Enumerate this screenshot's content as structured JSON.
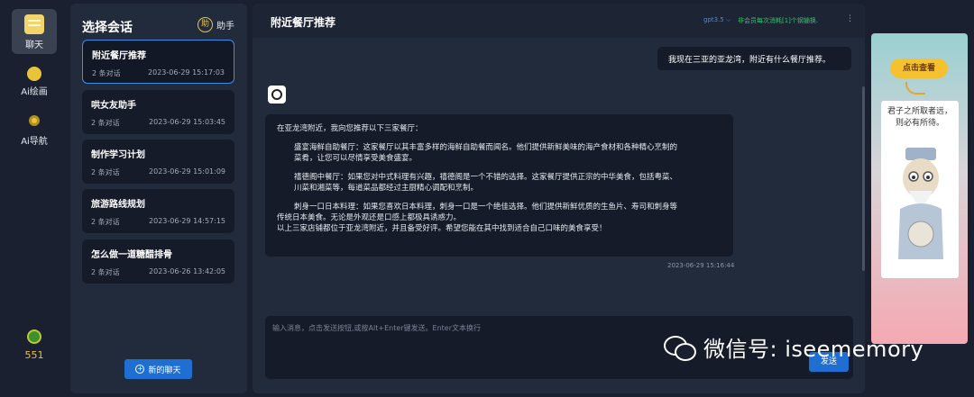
{
  "rail": {
    "chat_label": "聊天",
    "draw_label": "Ai绘画",
    "nav_label": "Ai导航",
    "coins": "551"
  },
  "conversations": {
    "heading": "选择会话",
    "assistant_badge": "助",
    "assistant_label": "助手",
    "items": [
      {
        "title": "附近餐厅推荐",
        "count": "2 条对话",
        "time": "2023-06-29 15:17:03",
        "active": true
      },
      {
        "title": "哄女友助手",
        "count": "2 条对话",
        "time": "2023-06-29 15:03:45",
        "active": false
      },
      {
        "title": "制作学习计划",
        "count": "2 条对话",
        "time": "2023-06-29 15:01:09",
        "active": false
      },
      {
        "title": "旅游路线规划",
        "count": "2 条对话",
        "time": "2023-06-29 14:57:15",
        "active": false
      },
      {
        "title": "怎么做一道糖醋排骨",
        "count": "2 条对话",
        "time": "2023-06-26 13:42:05",
        "active": false
      }
    ],
    "new_chat_label": "新的聊天"
  },
  "chat": {
    "title": "附近餐厅推荐",
    "model": "gpt3.5",
    "model_note": "非会员每次消耗[1]个钢镚换.",
    "menu": "⋮",
    "user_message": "我现在三亚的亚龙湾，附近有什么餐厅推荐。",
    "bot_lines": {
      "intro": "在亚龙湾附近，我向您推荐以下三家餐厅：",
      "r1a": "盛宴海鲜自助餐厅：这家餐厅以其丰富多样的海鲜自助餐而闻名。他们提供新鲜美味的海产食材和各种精心烹制的",
      "r1b": "菜肴，让您可以尽情享受美食盛宴。",
      "r2a": "禧德阁中餐厅：如果您对中式料理有兴趣，禧德阁是一个不错的选择。这家餐厅提供正宗的中华美食，包括粤菜、",
      "r2b": "川菜和湘菜等，每道菜品都经过主厨精心调配和烹制。",
      "r3a": "刺身一口日本料理：如果您喜欢日本料理，刺身一口是一个绝佳选择。他们提供新鲜优质的生鱼片、寿司和刺身等",
      "r3b": "传统日本美食。无论是外观还是口感上都极具诱惑力。",
      "outro": "以上三家店铺都位于亚龙湾附近，并且备受好评。希望您能在其中找到适合自己口味的美食享受！"
    },
    "bot_time": "2023-06-29 15:16:44",
    "input_placeholder": "输入消息，点击发送按钮,或按Alt+Enter键发送。Enter文本换行",
    "send_label": "发送"
  },
  "watermark": {
    "text": "微信号: iseememory"
  },
  "ad": {
    "button": "点击查看",
    "quote_line1": "君子之所取者远，",
    "quote_line2": "则必有所待。"
  },
  "colors": {
    "accent": "#1e6fd1",
    "gold": "#e9c439",
    "note_green": "#37c06a"
  }
}
